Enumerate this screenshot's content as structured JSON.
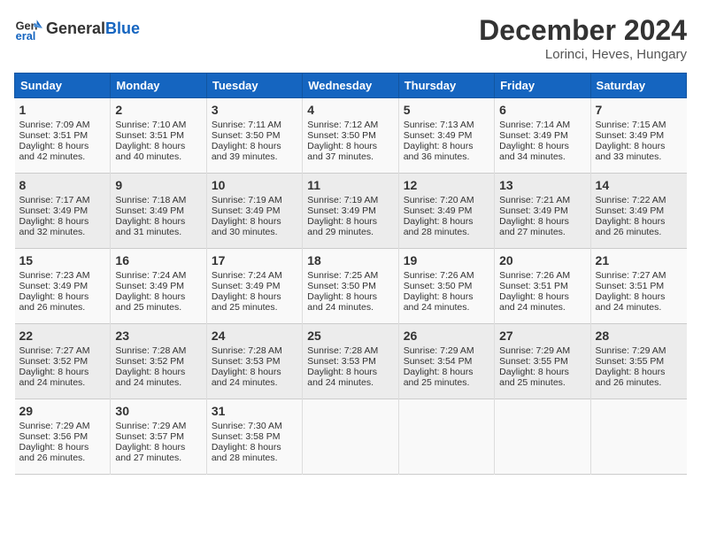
{
  "logo": {
    "general": "General",
    "blue": "Blue"
  },
  "title": "December 2024",
  "subtitle": "Lorinci, Heves, Hungary",
  "days_of_week": [
    "Sunday",
    "Monday",
    "Tuesday",
    "Wednesday",
    "Thursday",
    "Friday",
    "Saturday"
  ],
  "weeks": [
    [
      {
        "day": "1",
        "sunrise": "7:09 AM",
        "sunset": "3:51 PM",
        "daylight": "8 hours and 42 minutes."
      },
      {
        "day": "2",
        "sunrise": "7:10 AM",
        "sunset": "3:51 PM",
        "daylight": "8 hours and 40 minutes."
      },
      {
        "day": "3",
        "sunrise": "7:11 AM",
        "sunset": "3:50 PM",
        "daylight": "8 hours and 39 minutes."
      },
      {
        "day": "4",
        "sunrise": "7:12 AM",
        "sunset": "3:50 PM",
        "daylight": "8 hours and 37 minutes."
      },
      {
        "day": "5",
        "sunrise": "7:13 AM",
        "sunset": "3:49 PM",
        "daylight": "8 hours and 36 minutes."
      },
      {
        "day": "6",
        "sunrise": "7:14 AM",
        "sunset": "3:49 PM",
        "daylight": "8 hours and 34 minutes."
      },
      {
        "day": "7",
        "sunrise": "7:15 AM",
        "sunset": "3:49 PM",
        "daylight": "8 hours and 33 minutes."
      }
    ],
    [
      {
        "day": "8",
        "sunrise": "7:17 AM",
        "sunset": "3:49 PM",
        "daylight": "8 hours and 32 minutes."
      },
      {
        "day": "9",
        "sunrise": "7:18 AM",
        "sunset": "3:49 PM",
        "daylight": "8 hours and 31 minutes."
      },
      {
        "day": "10",
        "sunrise": "7:19 AM",
        "sunset": "3:49 PM",
        "daylight": "8 hours and 30 minutes."
      },
      {
        "day": "11",
        "sunrise": "7:19 AM",
        "sunset": "3:49 PM",
        "daylight": "8 hours and 29 minutes."
      },
      {
        "day": "12",
        "sunrise": "7:20 AM",
        "sunset": "3:49 PM",
        "daylight": "8 hours and 28 minutes."
      },
      {
        "day": "13",
        "sunrise": "7:21 AM",
        "sunset": "3:49 PM",
        "daylight": "8 hours and 27 minutes."
      },
      {
        "day": "14",
        "sunrise": "7:22 AM",
        "sunset": "3:49 PM",
        "daylight": "8 hours and 26 minutes."
      }
    ],
    [
      {
        "day": "15",
        "sunrise": "7:23 AM",
        "sunset": "3:49 PM",
        "daylight": "8 hours and 26 minutes."
      },
      {
        "day": "16",
        "sunrise": "7:24 AM",
        "sunset": "3:49 PM",
        "daylight": "8 hours and 25 minutes."
      },
      {
        "day": "17",
        "sunrise": "7:24 AM",
        "sunset": "3:49 PM",
        "daylight": "8 hours and 25 minutes."
      },
      {
        "day": "18",
        "sunrise": "7:25 AM",
        "sunset": "3:50 PM",
        "daylight": "8 hours and 24 minutes."
      },
      {
        "day": "19",
        "sunrise": "7:26 AM",
        "sunset": "3:50 PM",
        "daylight": "8 hours and 24 minutes."
      },
      {
        "day": "20",
        "sunrise": "7:26 AM",
        "sunset": "3:51 PM",
        "daylight": "8 hours and 24 minutes."
      },
      {
        "day": "21",
        "sunrise": "7:27 AM",
        "sunset": "3:51 PM",
        "daylight": "8 hours and 24 minutes."
      }
    ],
    [
      {
        "day": "22",
        "sunrise": "7:27 AM",
        "sunset": "3:52 PM",
        "daylight": "8 hours and 24 minutes."
      },
      {
        "day": "23",
        "sunrise": "7:28 AM",
        "sunset": "3:52 PM",
        "daylight": "8 hours and 24 minutes."
      },
      {
        "day": "24",
        "sunrise": "7:28 AM",
        "sunset": "3:53 PM",
        "daylight": "8 hours and 24 minutes."
      },
      {
        "day": "25",
        "sunrise": "7:28 AM",
        "sunset": "3:53 PM",
        "daylight": "8 hours and 24 minutes."
      },
      {
        "day": "26",
        "sunrise": "7:29 AM",
        "sunset": "3:54 PM",
        "daylight": "8 hours and 25 minutes."
      },
      {
        "day": "27",
        "sunrise": "7:29 AM",
        "sunset": "3:55 PM",
        "daylight": "8 hours and 25 minutes."
      },
      {
        "day": "28",
        "sunrise": "7:29 AM",
        "sunset": "3:55 PM",
        "daylight": "8 hours and 26 minutes."
      }
    ],
    [
      {
        "day": "29",
        "sunrise": "7:29 AM",
        "sunset": "3:56 PM",
        "daylight": "8 hours and 26 minutes."
      },
      {
        "day": "30",
        "sunrise": "7:29 AM",
        "sunset": "3:57 PM",
        "daylight": "8 hours and 27 minutes."
      },
      {
        "day": "31",
        "sunrise": "7:30 AM",
        "sunset": "3:58 PM",
        "daylight": "8 hours and 28 minutes."
      },
      null,
      null,
      null,
      null
    ]
  ]
}
